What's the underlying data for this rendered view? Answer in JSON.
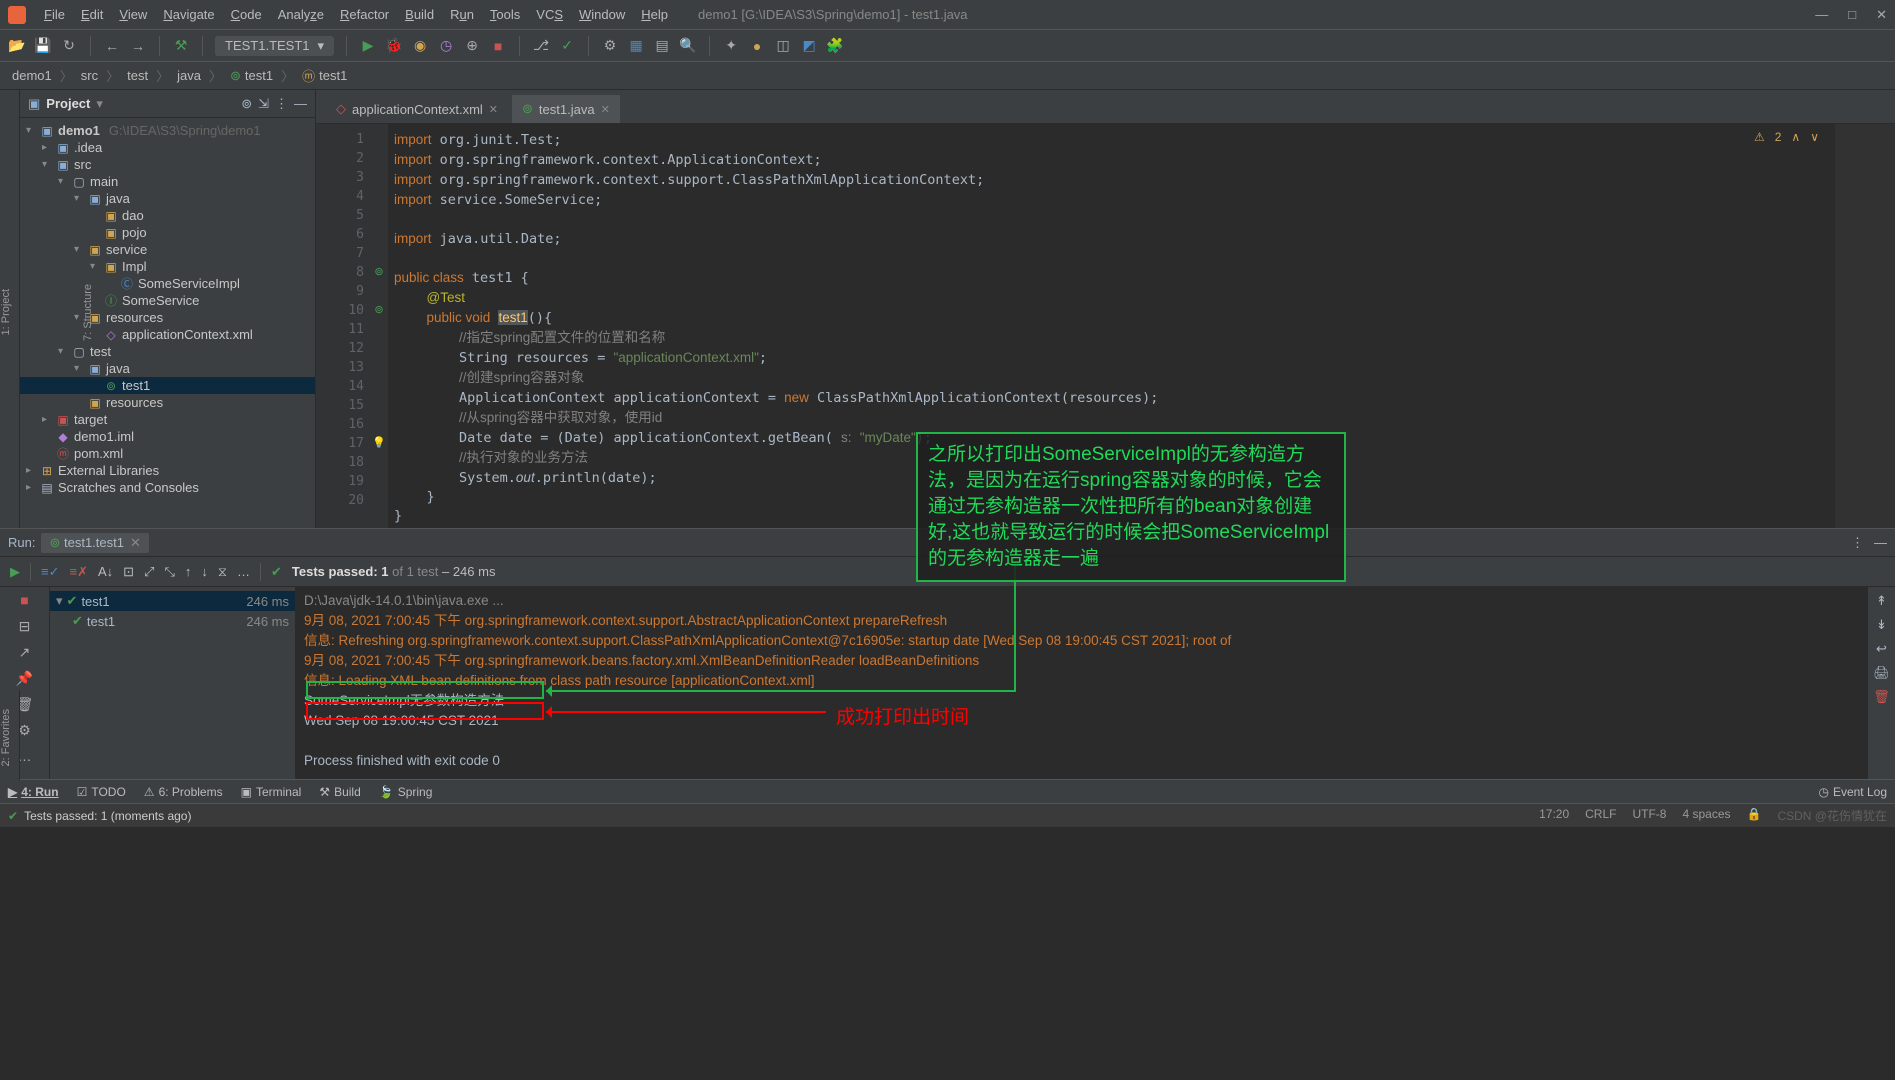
{
  "window": {
    "title": "demo1 [G:\\IDEA\\S3\\Spring\\demo1] - test1.java"
  },
  "menus": [
    "File",
    "Edit",
    "View",
    "Navigate",
    "Code",
    "Analyze",
    "Refactor",
    "Build",
    "Run",
    "Tools",
    "VCS",
    "Window",
    "Help"
  ],
  "menu_underline_idx": [
    0,
    0,
    0,
    0,
    0,
    4,
    0,
    0,
    1,
    0,
    2,
    0,
    0
  ],
  "run_config": "TEST1.TEST1",
  "breadcrumb": [
    "demo1",
    "src",
    "test",
    "java",
    "test1",
    "test1"
  ],
  "project": {
    "title": "Project",
    "root": {
      "label": "demo1",
      "hint": "G:\\IDEA\\S3\\Spring\\demo1"
    },
    "items": [
      ".idea",
      "src",
      "main",
      "java",
      "dao",
      "pojo",
      "service",
      "Impl",
      "SomeServiceImpl",
      "SomeService",
      "resources",
      "applicationContext.xml",
      "test",
      "java",
      "test1",
      "resources",
      "target",
      "demo1.iml",
      "pom.xml",
      "External Libraries",
      "Scratches and Consoles"
    ]
  },
  "tabs": [
    {
      "label": "applicationContext.xml",
      "icon": "xml"
    },
    {
      "label": "test1.java",
      "icon": "java",
      "active": true
    }
  ],
  "code_lines": [
    "import org.junit.Test;",
    "import org.springframework.context.ApplicationContext;",
    "import org.springframework.context.support.ClassPathXmlApplicationContext;",
    "import service.SomeService;",
    "",
    "import java.util.Date;",
    "",
    "public class test1 {",
    "    @Test",
    "    public void test1(){",
    "        //指定spring配置文件的位置和名称",
    "        String resources = \"applicationContext.xml\";",
    "        //创建spring容器对象",
    "        ApplicationContext applicationContext = new ClassPathXmlApplicationContext(resources);",
    "        //从spring容器中获取对象，使用id",
    "        Date date = (Date) applicationContext.getBean( s: \"myDate\");",
    "        //执行对象的业务方法",
    "        System.out.println(date);",
    "    }",
    "}"
  ],
  "editor": {
    "warning_count": "2"
  },
  "run": {
    "tab": "test1.test1",
    "label": "Run:",
    "passed_text": "Tests passed: 1 of 1 test – 246 ms",
    "tree": [
      {
        "label": "test1",
        "time": "246 ms",
        "sel": true
      },
      {
        "label": "test1",
        "time": "246 ms"
      }
    ],
    "console": [
      {
        "cls": "gray",
        "text": "D:\\Java\\jdk-14.0.1\\bin\\java.exe ..."
      },
      {
        "cls": "warn",
        "text": "9月 08, 2021 7:00:45 下午 org.springframework.context.support.AbstractApplicationContext prepareRefresh"
      },
      {
        "cls": "warn",
        "text": "信息: Refreshing org.springframework.context.support.ClassPathXmlApplicationContext@7c16905e: startup date [Wed Sep 08 19:00:45 CST 2021]; root of"
      },
      {
        "cls": "warn",
        "text": "9月 08, 2021 7:00:45 下午 org.springframework.beans.factory.xml.XmlBeanDefinitionReader loadBeanDefinitions"
      },
      {
        "cls": "warn",
        "text": "信息: Loading XML bean definitions from class path resource [applicationContext.xml]"
      },
      {
        "cls": "info",
        "text": "SomeServiceImpl无参数构造方法"
      },
      {
        "cls": "info",
        "text": "Wed Sep 08 19:00:45 CST 2021"
      },
      {
        "cls": "info",
        "text": ""
      },
      {
        "cls": "info",
        "text": "Process finished with exit code 0"
      }
    ]
  },
  "toolwindows": [
    "4: Run",
    "TODO",
    "6: Problems",
    "Terminal",
    "Build",
    "Spring"
  ],
  "toolwindows_right": "Event Log",
  "status": {
    "msg": "Tests passed: 1 (moments ago)",
    "right": [
      "17:20",
      "CRLF",
      "UTF-8",
      "4 spaces"
    ],
    "watermark": "CSDN @花伤情犹在"
  },
  "annotations": {
    "box1": "之所以打印出SomeServiceImpl的无参构造方法，是因为在运行spring容器对象的时候，它会通过无参构造器一次性把所有的bean对象创建好,这也就导致运行的时候会把SomeServiceImpl的无参构造器走一遍",
    "red_label": "成功打印出时间"
  }
}
